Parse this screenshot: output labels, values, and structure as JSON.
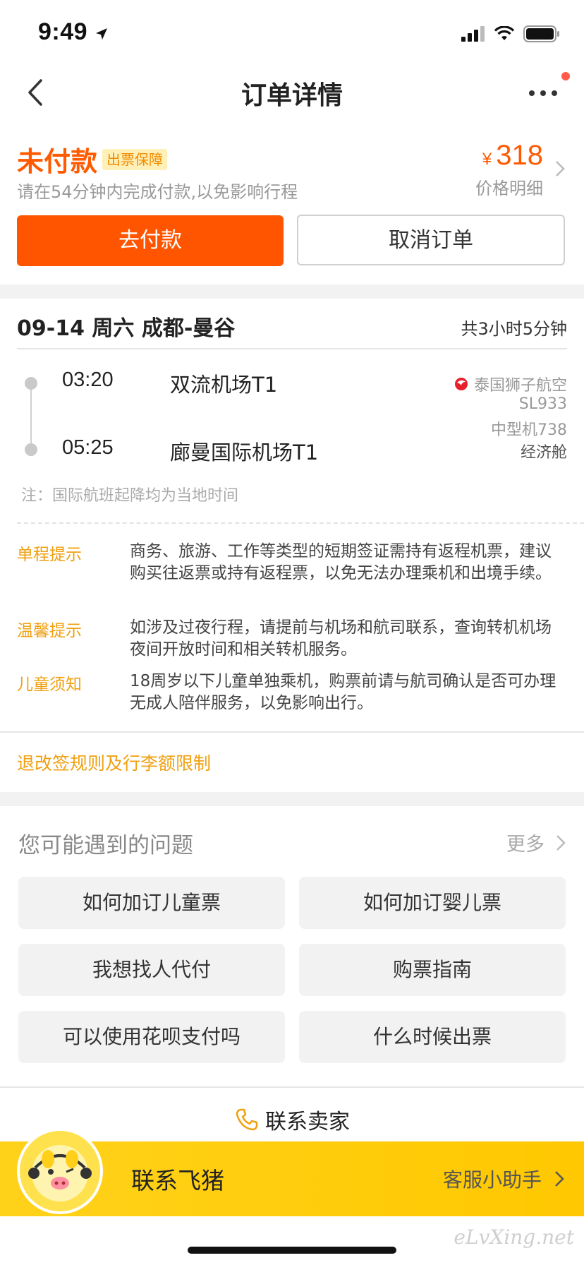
{
  "status_bar": {
    "time": "9:49"
  },
  "nav": {
    "title": "订单详情"
  },
  "order_status": {
    "status": "未付款",
    "badge": "出票保障",
    "hint": "请在54分钟内完成付款,以免影响行程",
    "currency": "¥",
    "price": "318",
    "price_detail": "价格明细",
    "pay_button": "去付款",
    "cancel_button": "取消订单"
  },
  "flight": {
    "route": "09-14 周六 成都-曼谷",
    "duration": "共3小时5分钟",
    "depart_time": "03:20",
    "depart_airport": "双流机场T1",
    "arrive_time": "05:25",
    "arrive_airport": "廊曼国际机场T1",
    "airline": "泰国狮子航空",
    "flight_no": "SL933",
    "aircraft": "中型机738",
    "cabin": "经济舱",
    "note": "注：国际航班起降均为当地时间"
  },
  "tips": [
    {
      "label": "单程提示",
      "text": "商务、旅游、工作等类型的短期签证需持有返程机票，建议购买往返票或持有返程票，以免无法办理乘机和出境手续。"
    },
    {
      "label": "温馨提示",
      "text": "如涉及过夜行程，请提前与机场和航司联系，查询转机机场夜间开放时间和相关转机服务。"
    },
    {
      "label": "儿童须知",
      "text": "18周岁以下儿童单独乘机，购票前请与航司确认是否可办理无成人陪伴服务，以免影响出行。"
    }
  ],
  "rules_link": "退改签规则及行李额限制",
  "faq": {
    "title": "您可能遇到的问题",
    "more": "更多",
    "items": [
      "如何加订儿童票",
      "如何加订婴儿票",
      "我想找人代付",
      "购票指南",
      "可以使用花呗支付吗",
      "什么时候出票"
    ]
  },
  "contact_seller": "联系卖家",
  "banner": {
    "title": "联系飞猪",
    "assistant": "客服小助手"
  },
  "watermark": "eLvXing.net",
  "colors": {
    "accent": "#ff5500",
    "tip": "#f0a010",
    "banner": "#ffd21a"
  }
}
